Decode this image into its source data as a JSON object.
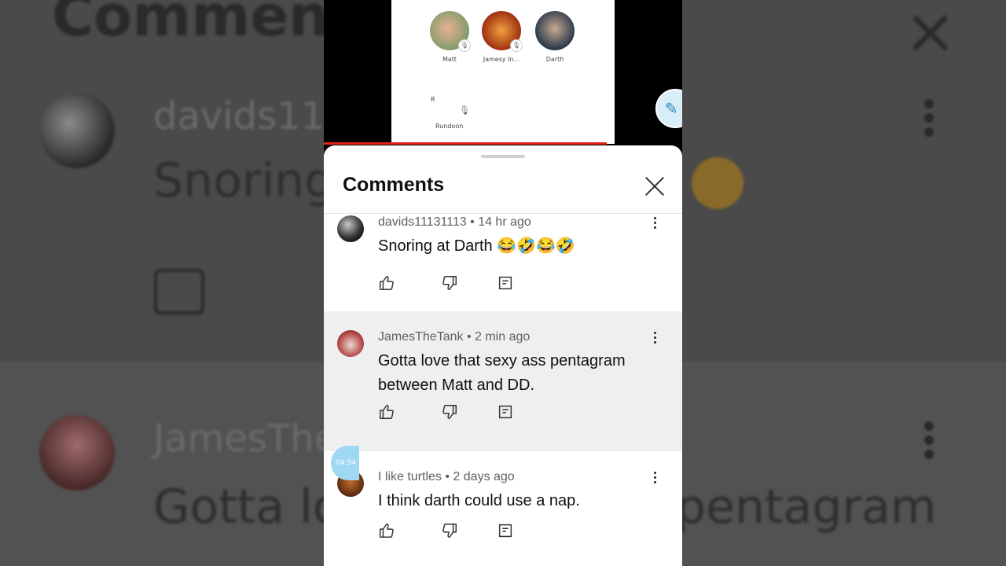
{
  "background": {
    "title": "Comments",
    "user1": "davids111",
    "text1": "Snoring",
    "user2": "JamesThe",
    "text2": "Gotta lo",
    "text2b": "pentagram"
  },
  "video": {
    "participants": [
      {
        "name": "Matt"
      },
      {
        "name": "Jamesy In..."
      },
      {
        "name": "Darth"
      }
    ],
    "rundown_letter": "R",
    "rundown_label": "Rundoon",
    "timer_badge": "04:54"
  },
  "sheet": {
    "title": "Comments",
    "comments": [
      {
        "author": "davids11131113",
        "time": "14 hr ago",
        "text": "Snoring at Darth 😂🤣😂🤣"
      },
      {
        "author": "JamesTheTank",
        "time": "2 min ago",
        "text": "Gotta love that sexy ass pentagram between Matt and DD."
      },
      {
        "author": "I like turtles",
        "time": "2 days ago",
        "text": "I think darth could use a nap."
      }
    ]
  },
  "colors": {
    "accent": "#e62117",
    "highlight_row": "#efefef"
  },
  "icons": [
    "like-icon",
    "dislike-icon",
    "reply-icon",
    "more-icon",
    "close-icon",
    "mic-icon"
  ]
}
